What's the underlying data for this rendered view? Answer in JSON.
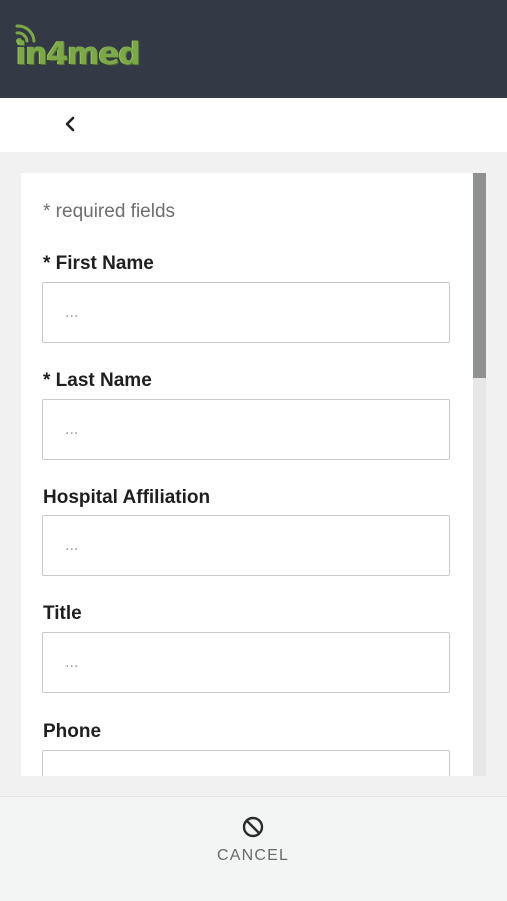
{
  "header": {
    "logo_text": "in4med",
    "logo_icon": "wifi-signal-icon"
  },
  "nav": {
    "back_icon": "chevron-left-icon"
  },
  "form": {
    "required_note": "* required fields",
    "fields": [
      {
        "label": "* First Name",
        "placeholder": "...",
        "value": ""
      },
      {
        "label": "* Last Name",
        "placeholder": "...",
        "value": ""
      },
      {
        "label": "Hospital Affiliation",
        "placeholder": "...",
        "value": ""
      },
      {
        "label": "Title",
        "placeholder": "...",
        "value": ""
      },
      {
        "label": "Phone",
        "placeholder": "",
        "value": ""
      }
    ]
  },
  "footer": {
    "cancel_label": "CANCEL",
    "cancel_icon": "cancel-circle-icon"
  },
  "colors": {
    "topbar": "#333945",
    "logo_green": "#7da84a",
    "background": "#f0f1f0"
  }
}
